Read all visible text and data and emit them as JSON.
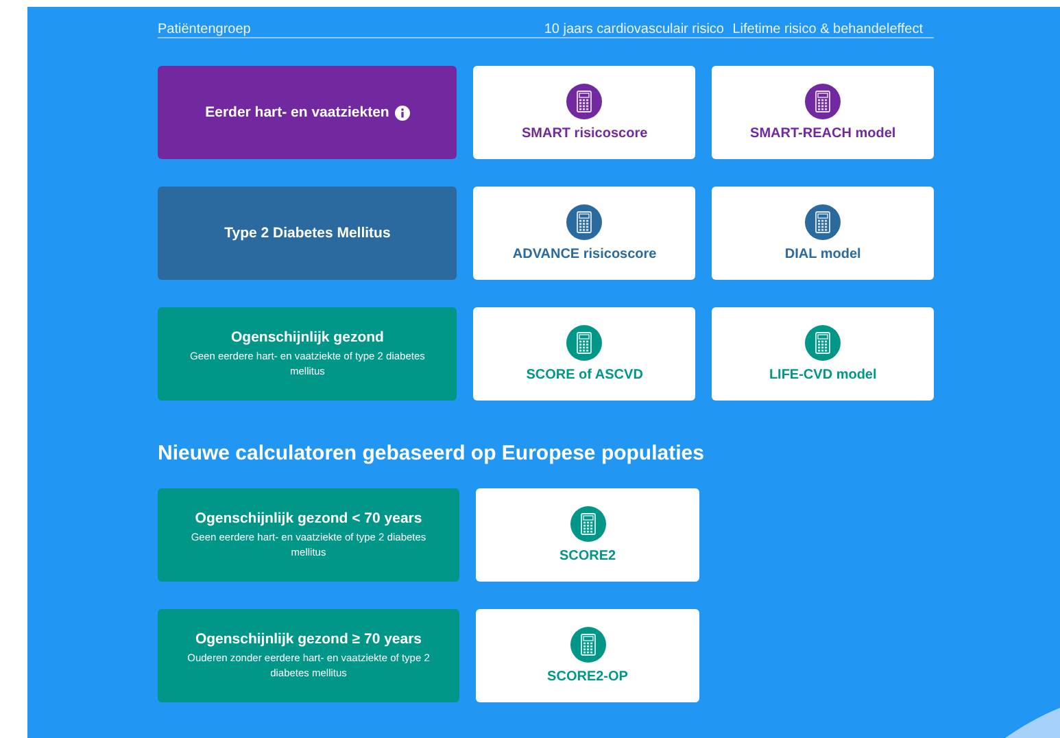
{
  "header": {
    "columns": [
      "Patiëntengroep",
      "10 jaars cardiovasculair risico",
      "Lifetime risico & behandeleffect"
    ]
  },
  "groups": [
    {
      "title": "Eerder hart- en vaatziekten",
      "info": true,
      "color": "#7229a0",
      "calculators": [
        "SMART risicoscore",
        "SMART-REACH model"
      ]
    },
    {
      "title": "Type 2 Diabetes Mellitus",
      "info": false,
      "color": "#2b6a9e",
      "calculators": [
        "ADVANCE risicoscore",
        "DIAL model"
      ]
    },
    {
      "title": "Ogenschijnlijk gezond",
      "subtitle": "Geen eerdere hart- en vaatziekte of type 2 diabetes mellitus",
      "info": false,
      "color": "#009688",
      "calculators": [
        "SCORE of ASCVD",
        "LIFE-CVD model"
      ]
    }
  ],
  "section_title": "Nieuwe calculatoren gebaseerd op Europese populaties",
  "new_groups": [
    {
      "title": "Ogenschijnlijk gezond < 70 years",
      "subtitle": "Geen eerdere hart- en vaatziekte of type 2 diabetes mellitus",
      "info": false,
      "color": "#009688",
      "calculators": [
        "SCORE2"
      ]
    },
    {
      "title": "Ogenschijnlijk gezond ≥ 70 years",
      "subtitle": "Ouderen zonder eerdere hart- en vaatziekte of type 2 diabetes mellitus",
      "info": false,
      "color": "#009688",
      "calculators": [
        "SCORE2-OP"
      ]
    }
  ]
}
